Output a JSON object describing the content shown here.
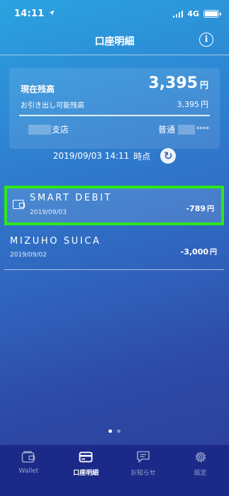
{
  "status_bar": {
    "time": "14:11",
    "network": "4G"
  },
  "header": {
    "title": "口座明細"
  },
  "balance": {
    "label": "現在残高",
    "amount": "3,395",
    "currency": "円",
    "available_label": "お引き出し可能残高",
    "available_amount": "3,395",
    "branch_suffix": "支店",
    "account_type": "普通",
    "account_masked": "****"
  },
  "as_of": {
    "datetime": "2019/09/03 14:11",
    "suffix": "時点"
  },
  "transactions": [
    {
      "name": "SMART DEBIT",
      "date": "2019/09/03",
      "amount": "-789",
      "currency": "円"
    },
    {
      "name": "MIZUHO SUICA",
      "date": "2019/09/02",
      "amount": "-3,000",
      "currency": "円"
    }
  ],
  "pager": {
    "count": 2,
    "active_index": 0
  },
  "tabs": [
    {
      "label": "Wallet",
      "icon": "wallet-icon"
    },
    {
      "label": "口座明細",
      "icon": "card-icon",
      "active": true
    },
    {
      "label": "お知らせ",
      "icon": "chat-icon"
    },
    {
      "label": "設定",
      "icon": "gear-icon"
    }
  ],
  "colors": {
    "highlight": "#2ee61b",
    "tab_bar": "#1b2a88"
  }
}
